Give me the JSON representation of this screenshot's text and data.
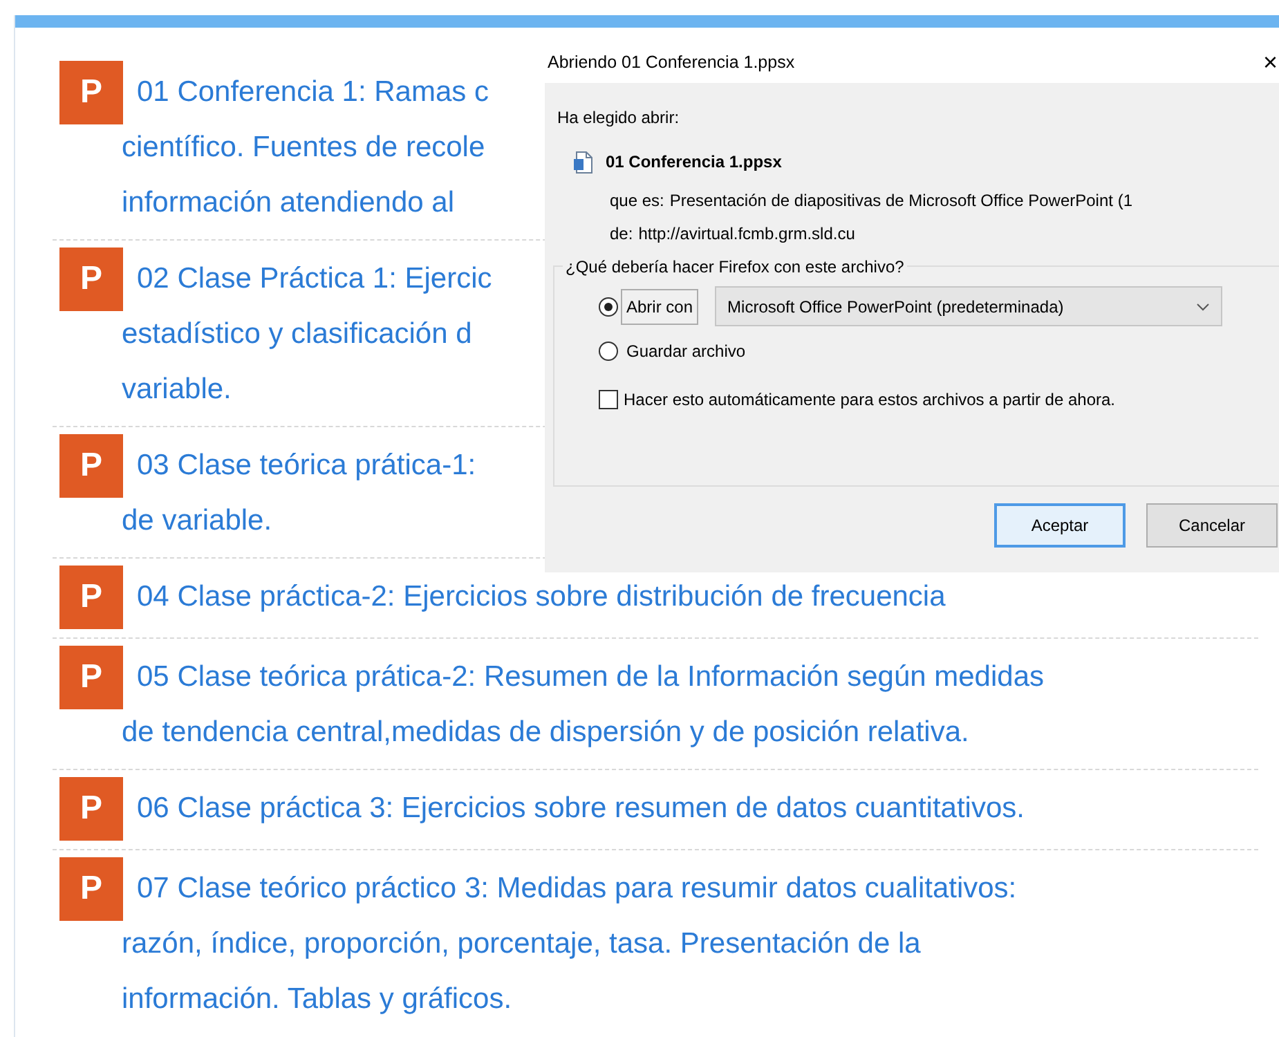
{
  "course_list": {
    "items": [
      {
        "icon_text": "P",
        "lines": [
          "01 Conferencia 1: Ramas c",
          "científico. Fuentes de recole",
          "información atendiendo al"
        ]
      },
      {
        "icon_text": "P",
        "lines": [
          "02 Clase Práctica 1: Ejercic",
          "estadístico y clasificación d",
          "variable."
        ]
      },
      {
        "icon_text": "P",
        "lines": [
          "03 Clase teórica prática-1:",
          "de variable."
        ]
      },
      {
        "icon_text": "P",
        "lines": [
          "04 Clase práctica-2: Ejercicios sobre distribución de frecuencia"
        ]
      },
      {
        "icon_text": "P",
        "lines": [
          "05 Clase teórica prática-2: Resumen de la Información según medidas",
          "de tendencia central,medidas de dispersión y de posición relativa."
        ]
      },
      {
        "icon_text": "P",
        "lines": [
          "06 Clase práctica 3: Ejercicios sobre resumen de datos cuantitativos."
        ]
      },
      {
        "icon_text": "P",
        "lines": [
          "07 Clase teórico práctico 3: Medidas para resumir datos cualitativos:",
          "razón, índice, proporción, porcentaje, tasa. Presentación de la",
          "información. Tablas y gráficos."
        ]
      }
    ]
  },
  "dialog": {
    "title": "Abriendo 01 Conferencia 1.ppsx",
    "close": "×",
    "intro": "Ha elegido abrir:",
    "file_name": "01 Conferencia 1.ppsx",
    "details": [
      {
        "label": "que es:",
        "value": "Presentación de diapositivas de Microsoft Office PowerPoint (1"
      },
      {
        "label": "de:",
        "value": "http://avirtual.fcmb.grm.sld.cu"
      }
    ],
    "group": {
      "legend": "¿Qué debería hacer Firefox con este archivo?",
      "options": [
        {
          "label": "Abrir con",
          "selected": true,
          "focused": true
        },
        {
          "label": "Guardar archivo",
          "selected": false,
          "focused": false
        }
      ],
      "app_select": {
        "value": "Microsoft Office PowerPoint (predeterminada)"
      },
      "auto_checkbox": {
        "label": "Hacer esto automáticamente para estos archivos a partir de ahora.",
        "checked": false
      }
    },
    "buttons": [
      {
        "label": "Aceptar",
        "default": true
      },
      {
        "label": "Cancelar",
        "default": false
      }
    ]
  }
}
